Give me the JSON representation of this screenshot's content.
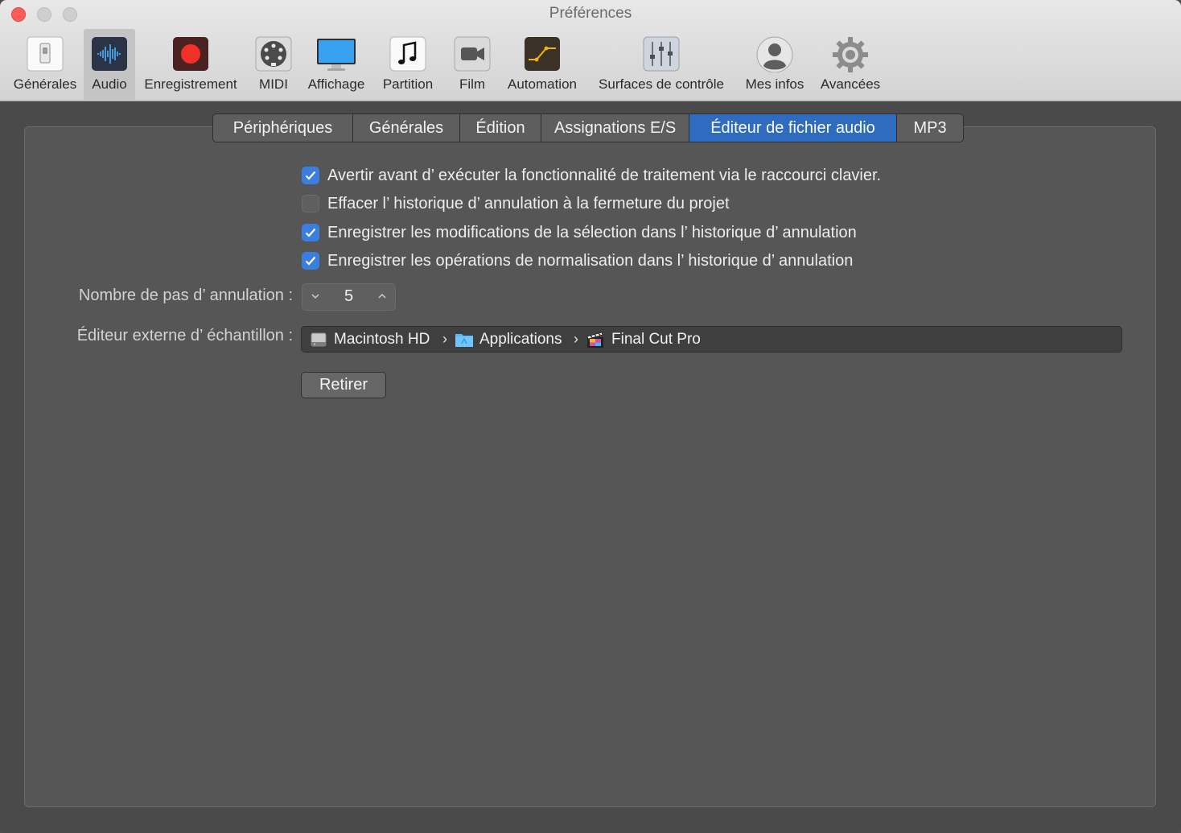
{
  "window": {
    "title": "Préférences"
  },
  "toolbar": {
    "items": [
      {
        "label": "Générales",
        "icon": "switch-icon"
      },
      {
        "label": "Audio",
        "icon": "waveform-icon",
        "active": true
      },
      {
        "label": "Enregistrement",
        "icon": "record-icon"
      },
      {
        "label": "MIDI",
        "icon": "midi-connector-icon"
      },
      {
        "label": "Affichage",
        "icon": "display-icon"
      },
      {
        "label": "Partition",
        "icon": "music-note-icon"
      },
      {
        "label": "Film",
        "icon": "video-camera-icon"
      },
      {
        "label": "Automation",
        "icon": "automation-curve-icon"
      },
      {
        "label": "Surfaces de contrôle",
        "icon": "faders-icon"
      },
      {
        "label": "Mes infos",
        "icon": "user-silhouette-icon"
      },
      {
        "label": "Avancées",
        "icon": "gear-icon"
      }
    ]
  },
  "tabs": [
    {
      "label": "Périphériques"
    },
    {
      "label": "Générales"
    },
    {
      "label": "Édition"
    },
    {
      "label": "Assignations E/S"
    },
    {
      "label": "Éditeur de fichier audio",
      "selected": true
    },
    {
      "label": "MP3"
    }
  ],
  "options": [
    {
      "label": "Avertir avant d’ exécuter la fonctionnalité de traitement via le raccourci clavier.",
      "checked": true
    },
    {
      "label": "Effacer l’ historique d’ annulation à la fermeture du projet",
      "checked": false
    },
    {
      "label": "Enregistrer les modifications de la sélection dans l’ historique d’ annulation",
      "checked": true
    },
    {
      "label": "Enregistrer les opérations de normalisation dans l’ historique d’ annulation",
      "checked": true
    }
  ],
  "undo_steps": {
    "label": "Nombre de pas d’ annulation :",
    "value": "5"
  },
  "external_editor": {
    "label": "Éditeur externe d’ échantillon :",
    "path": [
      {
        "label": "Macintosh HD",
        "icon": "hard-drive-icon"
      },
      {
        "label": "Applications",
        "icon": "folder-icon"
      },
      {
        "label": "Final Cut Pro",
        "icon": "clapperboard-icon"
      }
    ],
    "separator": "›"
  },
  "remove_button": {
    "label": "Retirer"
  },
  "colors": {
    "accent": "#2f6bbf",
    "checkbox": "#3a7ee0",
    "panel": "#565656",
    "record_red": "#f2302a"
  }
}
